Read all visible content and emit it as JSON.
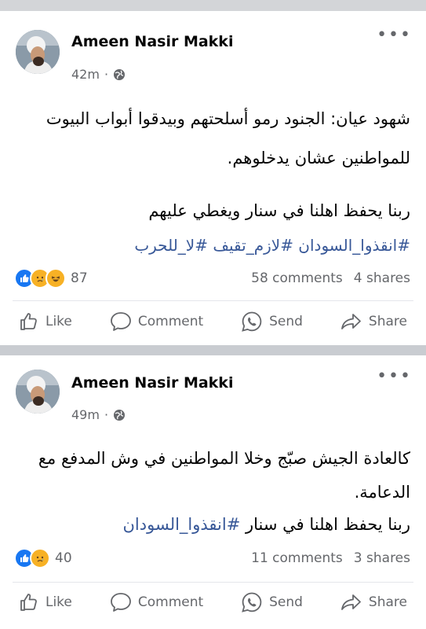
{
  "colors": {
    "accent": "#1877f2",
    "hashtag": "#385898",
    "muted": "#65676b"
  },
  "posts": [
    {
      "author": "Ameen Nasir Makki",
      "time": "42m",
      "lines": [
        "شهود عيان: الجنود رمو أسلحتهم وبيدقوا أبواب البيوت",
        "للمواطنين عشان يدخلوهم.",
        "ربنا يحفظ اهلنا في سنار ويغطي عليهم"
      ],
      "hashtags": "#انقذوا_السودان #لازم_تقيف #لا_للحرب",
      "reaction_icons": [
        "like",
        "sad",
        "haha"
      ],
      "reaction_count": "87",
      "comments": "58 comments",
      "shares": "4 shares"
    },
    {
      "author": "Ameen Nasir Makki",
      "time": "49m",
      "lines": [
        "كالعادة الجيش صبّج وخلا المواطنين في وش المدفع مع",
        "الدعامة.",
        "ربنا يحفظ اهلنا في سنار "
      ],
      "hashtags": "#انقذوا_السودان",
      "reaction_icons": [
        "like",
        "sad"
      ],
      "reaction_count": "40",
      "comments": "11 comments",
      "shares": "3 shares"
    }
  ],
  "actions": {
    "like": "Like",
    "comment": "Comment",
    "send": "Send",
    "share": "Share"
  },
  "meta_separator": "·"
}
